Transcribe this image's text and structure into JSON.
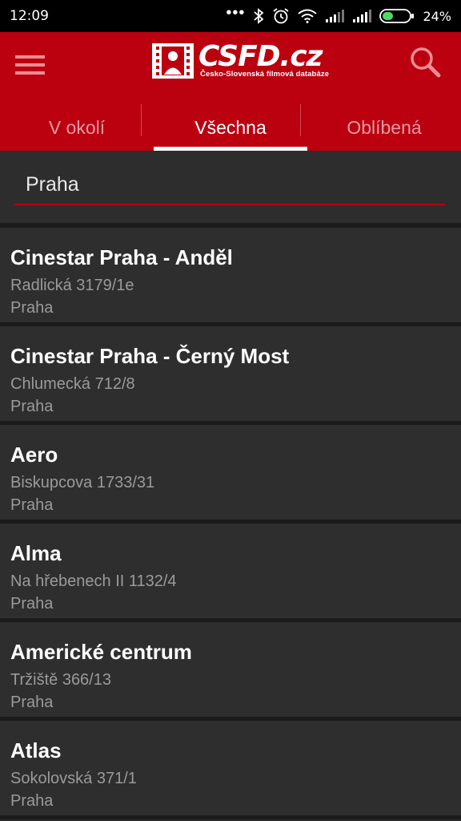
{
  "status_bar": {
    "time": "12:09",
    "battery_percent": "24%",
    "icons": [
      "more-dots-icon",
      "bluetooth-icon",
      "alarm-icon",
      "wifi-icon",
      "signal-icon",
      "signal-icon",
      "battery-icon"
    ]
  },
  "header": {
    "logo_text": "CSFD.cz",
    "logo_subtitle": "Česko-Slovenská filmová databáze",
    "brand_color": "#bb0010"
  },
  "tabs": [
    {
      "label": "V okolí",
      "active": false
    },
    {
      "label": "Všechna",
      "active": true
    },
    {
      "label": "Oblíbená",
      "active": false
    }
  ],
  "search": {
    "value": "Praha"
  },
  "cinemas": [
    {
      "name": "Cinestar Praha - Anděl",
      "address": "Radlická 3179/1e",
      "city": "Praha"
    },
    {
      "name": "Cinestar Praha - Černý Most",
      "address": "Chlumecká 712/8",
      "city": "Praha"
    },
    {
      "name": "Aero",
      "address": "Biskupcova 1733/31",
      "city": "Praha"
    },
    {
      "name": "Alma",
      "address": "Na hřebenech II 1132/4",
      "city": "Praha"
    },
    {
      "name": "Americké centrum",
      "address": "Tržiště 366/13",
      "city": "Praha"
    },
    {
      "name": "Atlas",
      "address": "Sokolovská 371/1",
      "city": "Praha"
    }
  ]
}
